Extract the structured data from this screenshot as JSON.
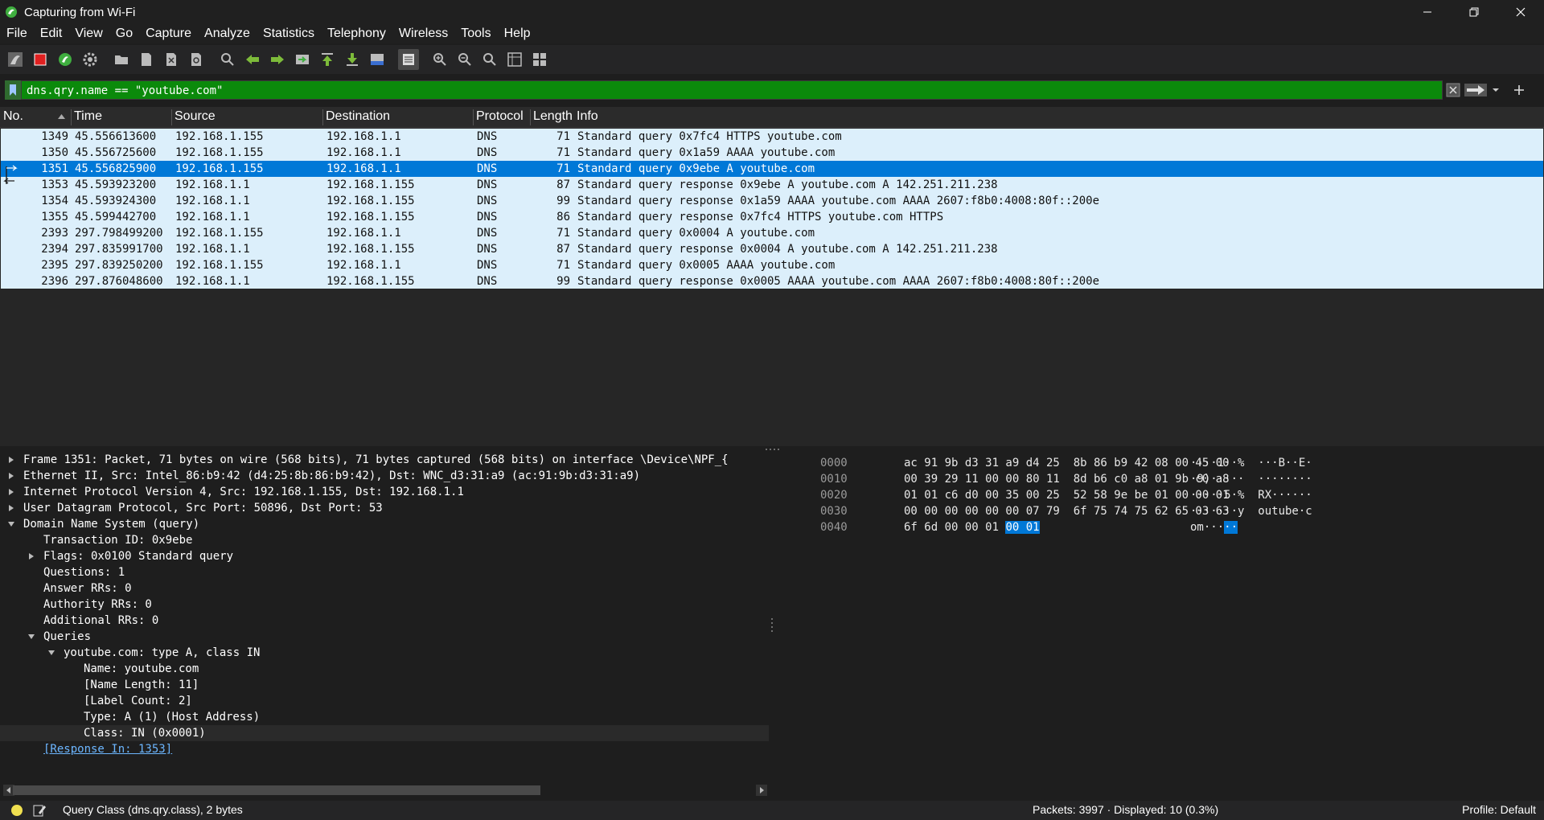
{
  "window": {
    "title": "Capturing from Wi-Fi"
  },
  "menu": [
    "File",
    "Edit",
    "View",
    "Go",
    "Capture",
    "Analyze",
    "Statistics",
    "Telephony",
    "Wireless",
    "Tools",
    "Help"
  ],
  "toolbar": {
    "icons": [
      "shark-fin-start-icon",
      "stop-icon",
      "restart-icon",
      "options-gear-icon",
      "open-folder-icon",
      "save-file-icon",
      "close-file-icon",
      "reload-icon",
      "find-icon",
      "back-arrow-icon",
      "forward-arrow-icon",
      "go-to-packet-icon",
      "first-packet-icon",
      "last-packet-icon",
      "auto-scroll-icon",
      "colorize-icon",
      "zoom-in-icon",
      "zoom-out-icon",
      "zoom-normal-icon",
      "resize-columns-icon",
      "layout-icon"
    ]
  },
  "filter": {
    "value": "dns.qry.name == \"youtube.com\"",
    "color": "#0b8a0b"
  },
  "packet_list": {
    "columns": [
      "No.",
      "Time",
      "Source",
      "Destination",
      "Protocol",
      "Length",
      "Info"
    ],
    "rows": [
      {
        "no": "1349",
        "time": "45.556613600",
        "src": "192.168.1.155",
        "dst": "192.168.1.1",
        "proto": "DNS",
        "len": "71",
        "info": "Standard query 0x7fc4 HTTPS youtube.com"
      },
      {
        "no": "1350",
        "time": "45.556725600",
        "src": "192.168.1.155",
        "dst": "192.168.1.1",
        "proto": "DNS",
        "len": "71",
        "info": "Standard query 0x1a59 AAAA youtube.com"
      },
      {
        "no": "1351",
        "time": "45.556825900",
        "src": "192.168.1.155",
        "dst": "192.168.1.1",
        "proto": "DNS",
        "len": "71",
        "info": "Standard query 0x9ebe A youtube.com"
      },
      {
        "no": "1353",
        "time": "45.593923200",
        "src": "192.168.1.1",
        "dst": "192.168.1.155",
        "proto": "DNS",
        "len": "87",
        "info": "Standard query response 0x9ebe A youtube.com A 142.251.211.238"
      },
      {
        "no": "1354",
        "time": "45.593924300",
        "src": "192.168.1.1",
        "dst": "192.168.1.155",
        "proto": "DNS",
        "len": "99",
        "info": "Standard query response 0x1a59 AAAA youtube.com AAAA 2607:f8b0:4008:80f::200e"
      },
      {
        "no": "1355",
        "time": "45.599442700",
        "src": "192.168.1.1",
        "dst": "192.168.1.155",
        "proto": "DNS",
        "len": "86",
        "info": "Standard query response 0x7fc4 HTTPS youtube.com HTTPS"
      },
      {
        "no": "2393",
        "time": "297.798499200",
        "src": "192.168.1.155",
        "dst": "192.168.1.1",
        "proto": "DNS",
        "len": "71",
        "info": "Standard query 0x0004 A youtube.com"
      },
      {
        "no": "2394",
        "time": "297.835991700",
        "src": "192.168.1.1",
        "dst": "192.168.1.155",
        "proto": "DNS",
        "len": "87",
        "info": "Standard query response 0x0004 A youtube.com A 142.251.211.238"
      },
      {
        "no": "2395",
        "time": "297.839250200",
        "src": "192.168.1.155",
        "dst": "192.168.1.1",
        "proto": "DNS",
        "len": "71",
        "info": "Standard query 0x0005 AAAA youtube.com"
      },
      {
        "no": "2396",
        "time": "297.876048600",
        "src": "192.168.1.1",
        "dst": "192.168.1.155",
        "proto": "DNS",
        "len": "99",
        "info": "Standard query response 0x0005 AAAA youtube.com AAAA 2607:f8b0:4008:80f::200e"
      }
    ],
    "selected_no": "1351"
  },
  "details": [
    {
      "text": "Frame 1351: Packet, 71 bytes on wire (568 bits), 71 bytes captured (568 bits) on interface \\Device\\NPF_{",
      "level": 0,
      "arrow": "right"
    },
    {
      "text": "Ethernet II, Src: Intel_86:b9:42 (d4:25:8b:86:b9:42), Dst: WNC_d3:31:a9 (ac:91:9b:d3:31:a9)",
      "level": 0,
      "arrow": "right"
    },
    {
      "text": "Internet Protocol Version 4, Src: 192.168.1.155, Dst: 192.168.1.1",
      "level": 0,
      "arrow": "right"
    },
    {
      "text": "User Datagram Protocol, Src Port: 50896, Dst Port: 53",
      "level": 0,
      "arrow": "right"
    },
    {
      "text": "Domain Name System (query)",
      "level": 0,
      "arrow": "down"
    },
    {
      "text": "Transaction ID: 0x9ebe",
      "level": 1,
      "arrow": ""
    },
    {
      "text": "Flags: 0x0100 Standard query",
      "level": 1,
      "arrow": "right"
    },
    {
      "text": "Questions: 1",
      "level": 1,
      "arrow": ""
    },
    {
      "text": "Answer RRs: 0",
      "level": 1,
      "arrow": ""
    },
    {
      "text": "Authority RRs: 0",
      "level": 1,
      "arrow": ""
    },
    {
      "text": "Additional RRs: 0",
      "level": 1,
      "arrow": ""
    },
    {
      "text": "Queries",
      "level": 1,
      "arrow": "down"
    },
    {
      "text": "youtube.com: type A, class IN",
      "level": 2,
      "arrow": "down"
    },
    {
      "text": "Name: youtube.com",
      "level": 3,
      "arrow": ""
    },
    {
      "text": "[Name Length: 11]",
      "level": 3,
      "arrow": ""
    },
    {
      "text": "[Label Count: 2]",
      "level": 3,
      "arrow": ""
    },
    {
      "text": "Type: A (1) (Host Address)",
      "level": 3,
      "arrow": ""
    },
    {
      "text": "Class: IN (0x0001)",
      "level": 3,
      "arrow": "",
      "highlight": true
    },
    {
      "text": "[Response In: 1353]",
      "level": 1,
      "arrow": "",
      "link": true
    }
  ],
  "bytes": [
    {
      "offset": "0000",
      "hex": "ac 91 9b d3 31 a9 d4 25  8b 86 b9 42 08 00 45 00",
      "ascii": "····1··%  ···B··E·"
    },
    {
      "offset": "0010",
      "hex": "00 39 29 11 00 00 80 11  8d b6 c0 a8 01 9b c0 a8",
      "ascii": "·9)·····  ········"
    },
    {
      "offset": "0020",
      "hex": "01 01 c6 d0 00 35 00 25  52 58 9e be 01 00 00 01",
      "ascii": "·····5·%  RX······"
    },
    {
      "offset": "0030",
      "hex": "00 00 00 00 00 00 07 79  6f 75 74 75 62 65 03 63",
      "ascii": "·······y  outube·c"
    },
    {
      "offset": "0040",
      "hex": "6f 6d 00 00 01 ",
      "hex_sel": "00 01",
      "ascii": "om···",
      "ascii_sel": "··"
    }
  ],
  "status": {
    "field_text": "Query Class (dns.qry.class), 2 bytes",
    "packets": "Packets: 3997 · Displayed: 10 (0.3%)",
    "profile": "Profile: Default"
  }
}
